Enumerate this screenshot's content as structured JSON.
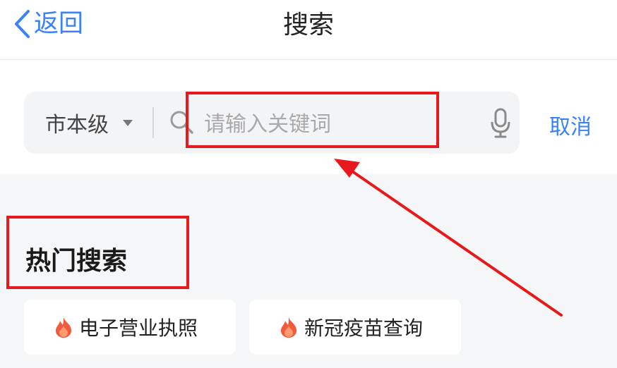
{
  "header": {
    "back_label": "返回",
    "back_icon": "chevron-left-icon",
    "title": "搜索"
  },
  "search": {
    "scope_label": "市本级",
    "placeholder": "请输入关键词",
    "value": "",
    "search_icon": "search-icon",
    "mic_icon": "microphone-icon",
    "cancel_label": "取消"
  },
  "hot": {
    "title": "热门搜索",
    "items": [
      {
        "label": "电子营业执照",
        "icon": "flame-icon"
      },
      {
        "label": "新冠疫苗查询",
        "icon": "flame-icon"
      }
    ]
  },
  "colors": {
    "accent": "#3a82f6",
    "annotation": "#e8191c",
    "flame": "#f25a3c"
  }
}
